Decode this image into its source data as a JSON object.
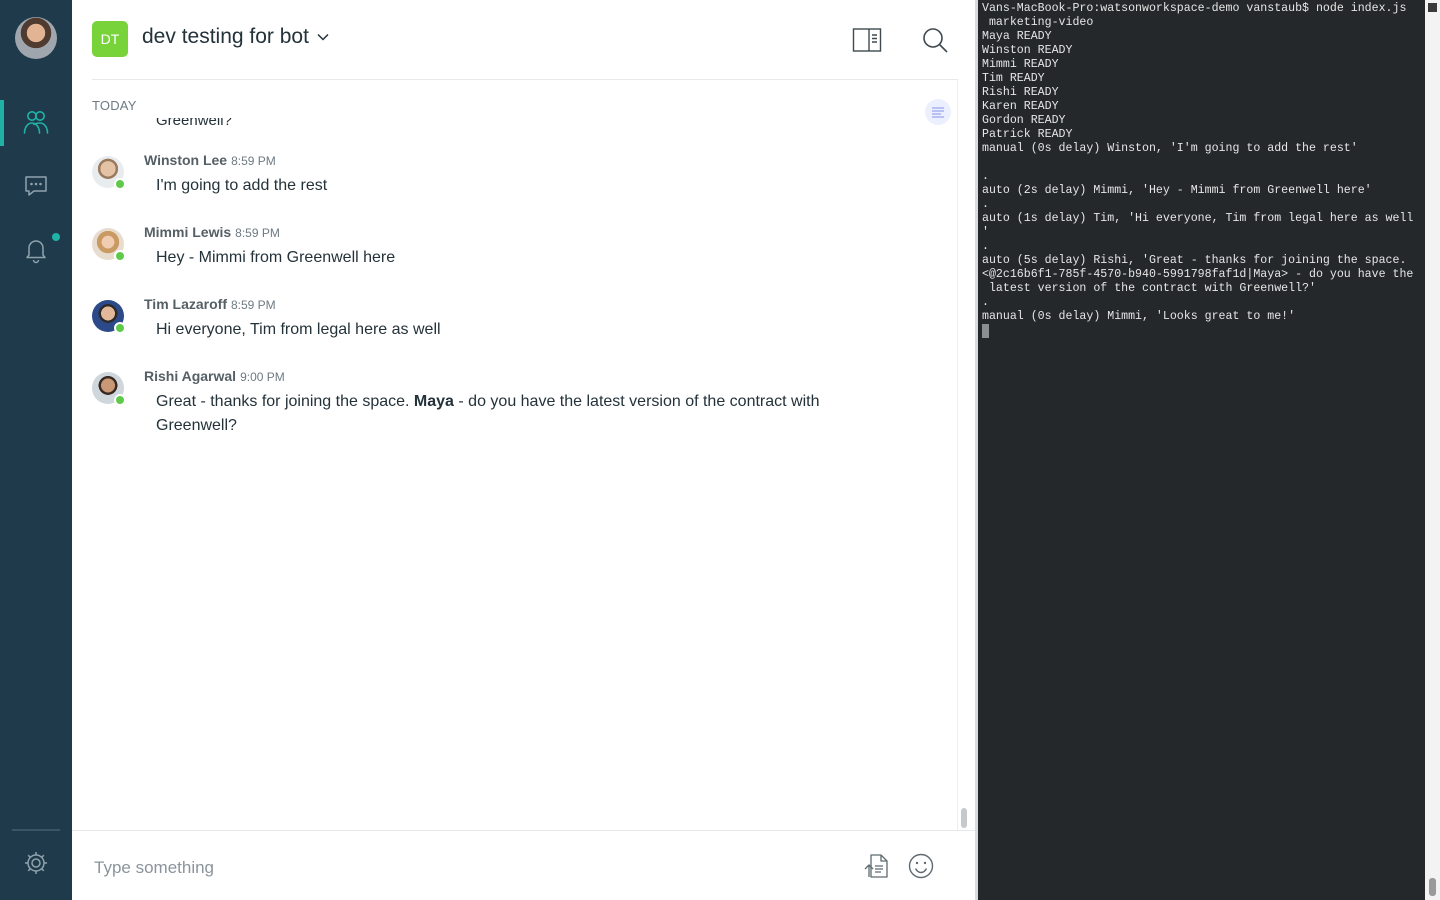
{
  "space": {
    "initials": "DT",
    "title": "dev testing for bot",
    "badge_color": "#78d33b"
  },
  "nav": {
    "items": [
      {
        "name": "spaces-icon",
        "active": true
      },
      {
        "name": "chat-icon",
        "active": false
      },
      {
        "name": "notifications-icon",
        "active": false,
        "has_unread_dot": true
      }
    ],
    "settings_icon": "gear-icon"
  },
  "header_icons": [
    "sidebar-toggle-icon",
    "search-icon"
  ],
  "chat": {
    "day_label": "TODAY",
    "partial_previous_text": "Greenwell?",
    "messages": [
      {
        "author": "Winston Lee",
        "time": "8:59 PM",
        "text": "I'm going to add the rest"
      },
      {
        "author": "Mimmi Lewis",
        "time": "8:59 PM",
        "text": "Hey - Mimmi from Greenwell here"
      },
      {
        "author": "Tim Lazaroff",
        "time": "8:59 PM",
        "text": "Hi everyone, Tim from legal here as well"
      },
      {
        "author": "Rishi Agarwal",
        "time": "9:00 PM",
        "text_before": "Great - thanks for joining the space. ",
        "mention": "Maya",
        "text_after": " - do you have the latest version of the contract with Greenwell?"
      }
    ]
  },
  "composer": {
    "placeholder": "Type something",
    "icons": [
      "upload-file-icon",
      "emoji-icon"
    ]
  },
  "terminal": {
    "lines": [
      "Vans-MacBook-Pro:watsonworkspace-demo vanstaub$ node index.js",
      " marketing-video",
      "Maya READY",
      "Winston READY",
      "Mimmi READY",
      "Tim READY",
      "Rishi READY",
      "Karen READY",
      "Gordon READY",
      "Patrick READY",
      "manual (0s delay) Winston, 'I'm going to add the rest'",
      "",
      ".",
      "auto (2s delay) Mimmi, 'Hey - Mimmi from Greenwell here'",
      ".",
      "auto (1s delay) Tim, 'Hi everyone, Tim from legal here as well",
      "'",
      ".",
      "auto (5s delay) Rishi, 'Great - thanks for joining the space.",
      "<@2c16b6f1-785f-4570-b940-5991798faf1d|Maya> - do you have the",
      " latest version of the contract with Greenwell?'",
      ".",
      "manual (0s delay) Mimmi, 'Looks great to me!'"
    ]
  },
  "colors": {
    "rail": "#1f3a4a",
    "accent": "#1fb3a6",
    "presence": "#5fc94a",
    "terminal_bg": "#24282b"
  }
}
